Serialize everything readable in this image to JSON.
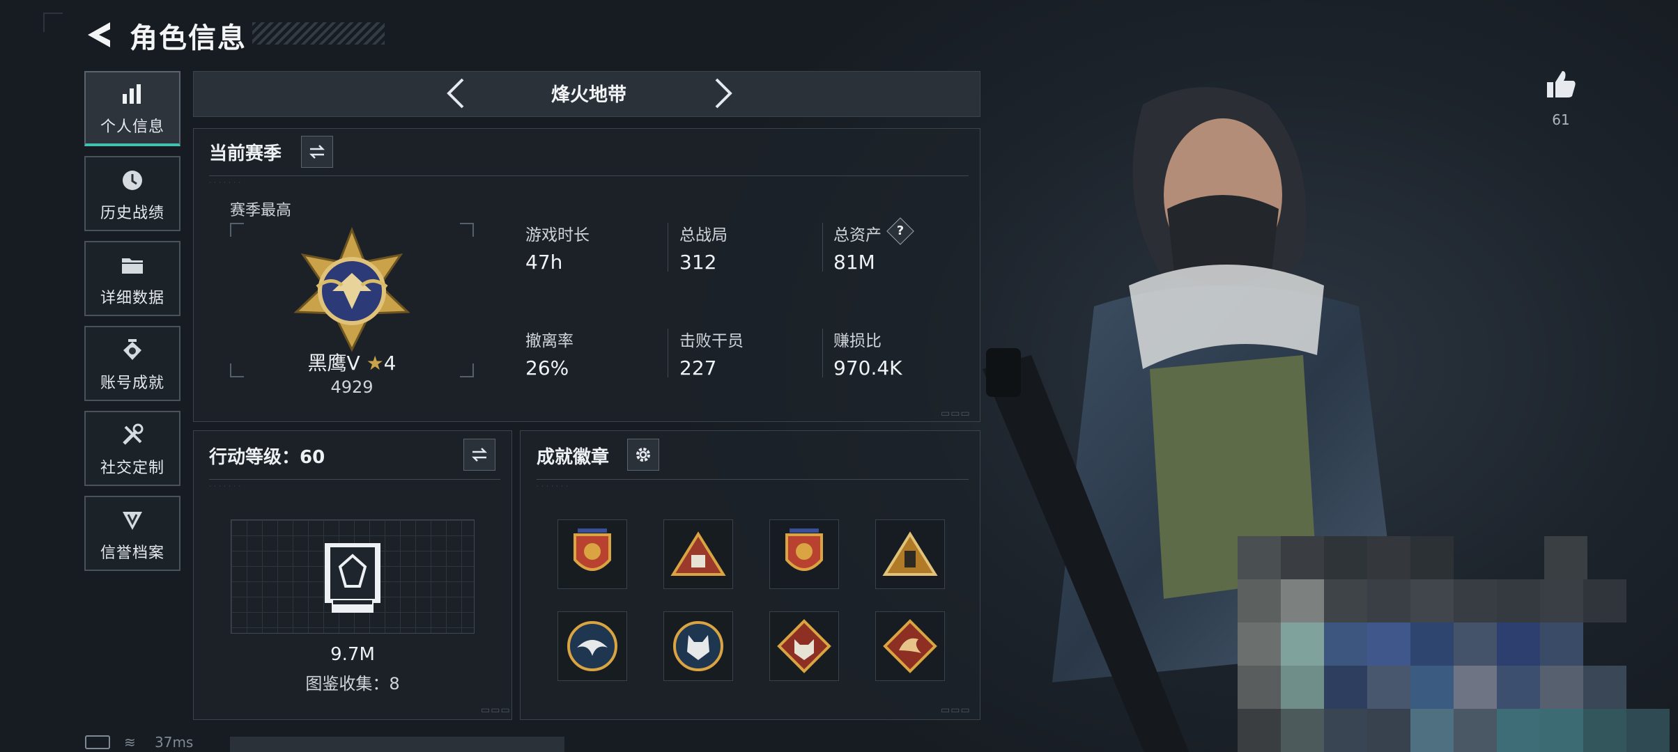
{
  "header": {
    "title": "角色信息"
  },
  "sidebar": {
    "items": [
      {
        "label": "个人信息",
        "icon": "bar-chart-icon"
      },
      {
        "label": "历史战绩",
        "icon": "history-clock-icon"
      },
      {
        "label": "详细数据",
        "icon": "folder-icon"
      },
      {
        "label": "账号成就",
        "icon": "achievement-icon"
      },
      {
        "label": "社交定制",
        "icon": "tools-icon"
      },
      {
        "label": "信誉档案",
        "icon": "reputation-icon"
      }
    ]
  },
  "season": {
    "name": "烽火地带"
  },
  "current_season": {
    "title": "当前赛季",
    "highest_label": "赛季最高",
    "rank_name": "黑鹰Ⅴ",
    "rank_stars": "4",
    "rank_score": "4929",
    "stats": [
      {
        "label": "游戏时长",
        "value": "47h"
      },
      {
        "label": "总战局",
        "value": "312"
      },
      {
        "label": "总资产",
        "value": "81M",
        "help": "?"
      },
      {
        "label": "撤离率",
        "value": "26%"
      },
      {
        "label": "击败干员",
        "value": "227"
      },
      {
        "label": "赚损比",
        "value": "970.4K"
      }
    ]
  },
  "action_level": {
    "title": "行动等级：60",
    "value": "9.7M",
    "collection": "图鉴收集：8"
  },
  "badges": {
    "title": "成就徽章"
  },
  "likes": {
    "count": "61"
  },
  "status_bar": {
    "ping": "37ms"
  },
  "colors": {
    "accent": "#3fc3b0",
    "gold": "#c9a24a",
    "panel": "#1c2229"
  }
}
